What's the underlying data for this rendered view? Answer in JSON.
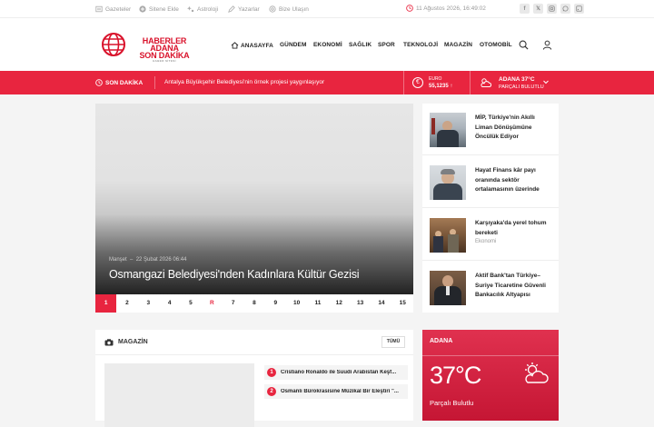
{
  "topbar": {
    "links": [
      {
        "label": "Gazeteler",
        "icon": "newspaper-icon"
      },
      {
        "label": "Sitene Ekle",
        "icon": "plus-circle-icon"
      },
      {
        "label": "Astroloji",
        "icon": "stars-icon"
      },
      {
        "label": "Yazarlar",
        "icon": "pen-icon"
      },
      {
        "label": "Bize Ulaşın",
        "icon": "at-icon"
      }
    ],
    "datetime": "11 Ağustos 2026, 16:49:02",
    "social": [
      "facebook-icon",
      "x-icon",
      "instagram-icon",
      "whatsapp-icon",
      "rss-icon"
    ]
  },
  "logo": {
    "line1": "HABERLER ADANA",
    "line2": "SON DAKİKA",
    "tagline": "HABER SİTESİ"
  },
  "nav": {
    "home": "ANASAYFA",
    "items": [
      "GÜNDEM",
      "EKONOMİ",
      "SAĞLIK",
      "SPOR",
      "TEKNOLOJİ",
      "MAGAZİN",
      "OTOMOBİL"
    ]
  },
  "breaking": {
    "label": "SON DAKİKA",
    "text": "Antalya Büyükşehir Belediyesi'nin örnek projesi yaygınlaşıyor"
  },
  "currency": {
    "name": "EURO",
    "value": "55,1235 ↑",
    "symbol": "€"
  },
  "weather_bar": {
    "city": "ADANA",
    "temp": "37°C",
    "condition": "PARÇALI BULUTLU"
  },
  "slider": {
    "category": "Manşet",
    "date": "22 Şubat 2026 06:44",
    "title": "Osmangazi Belediyesi'nden Kadınlara Kültür Gezisi",
    "pages": [
      "1",
      "2",
      "3",
      "4",
      "5",
      "R",
      "7",
      "8",
      "9",
      "10",
      "11",
      "12",
      "13",
      "14",
      "15"
    ]
  },
  "side_news": [
    {
      "title": "MİP, Türkiye'nin Akıllı Liman Dönüşümüne Öncülük Ediyor",
      "category": ""
    },
    {
      "title": "Hayat Finans kâr payı oranında sektör ortalamasının üzerinde",
      "category": ""
    },
    {
      "title": "Karşıyaka'da yerel tohum bereketi",
      "category": "Ekonomi"
    },
    {
      "title": "Aktif Bank'tan Türkiye–Suriye Ticaretine Güvenli Bankacılık Altyapısı",
      "category": ""
    }
  ],
  "magazin": {
    "title": "MAGAZİN",
    "all_label": "TÜMÜ",
    "items": [
      {
        "num": "1",
        "title": "Cristiano Ronaldo ile Suudi Arabistan Keşf..."
      },
      {
        "num": "2",
        "title": "Osmanlı Bürokrasisine Müzikal Bir Eleştiri \"..."
      }
    ]
  },
  "weather_widget": {
    "city": "ADANA",
    "temp": "37°C",
    "condition": "Parçalı Bulutlu"
  },
  "colors": {
    "accent": "#e8253f",
    "logo_red": "#d9122b"
  }
}
